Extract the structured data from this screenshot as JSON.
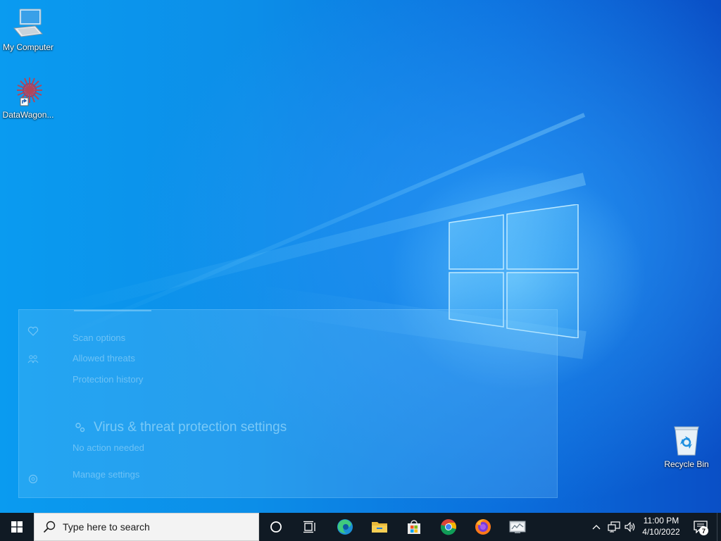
{
  "desktop": {
    "icons": [
      {
        "label": "My Computer",
        "icon": "computer-icon"
      },
      {
        "label": "DataWagon...",
        "icon": "datawagon-shortcut-icon"
      },
      {
        "label": "Recycle Bin",
        "icon": "recycle-bin-icon"
      }
    ]
  },
  "security_panel": {
    "items": [
      "Scan options",
      "Allowed threats",
      "Protection history"
    ],
    "section_title": "Virus & threat protection settings",
    "section_status": "No action needed",
    "manage_link": "Manage settings"
  },
  "taskbar": {
    "search_placeholder": "Type here to search",
    "apps": [
      {
        "name": "cortana",
        "icon": "cortana-circle-icon"
      },
      {
        "name": "task-view",
        "icon": "task-view-icon"
      },
      {
        "name": "edge",
        "icon": "edge-icon"
      },
      {
        "name": "file-explorer",
        "icon": "folder-icon"
      },
      {
        "name": "store",
        "icon": "store-bag-icon"
      },
      {
        "name": "chrome",
        "icon": "chrome-icon"
      },
      {
        "name": "firefox",
        "icon": "firefox-icon"
      },
      {
        "name": "system-monitor",
        "icon": "monitor-window-icon"
      }
    ],
    "tray": {
      "time": "11:00 PM",
      "date": "4/10/2022",
      "notification_count": "7"
    }
  },
  "colors": {
    "taskbar_bg": "#101a24",
    "desktop_blue": "#0b78e0",
    "search_bg": "#f3f3f3"
  }
}
